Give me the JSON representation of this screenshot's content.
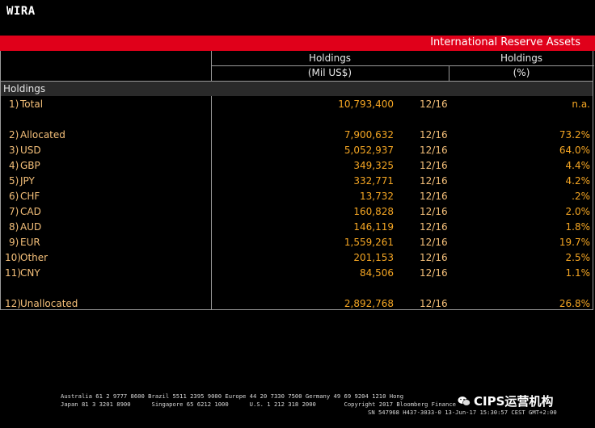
{
  "command": "WIRA",
  "title_bar": "International Reserve Assets",
  "columns": {
    "holdings_label": "Holdings",
    "holdings_unit": "(Mil US$)",
    "pct_label": "Holdings",
    "pct_unit": "(%)"
  },
  "section_label": "Holdings",
  "rows": [
    {
      "idx": "1)",
      "label": "Total",
      "value": "10,793,400",
      "date": "12/16",
      "pct": "n.a."
    },
    {
      "idx": "2)",
      "label": "Allocated",
      "value": "7,900,632",
      "date": "12/16",
      "pct": "73.2%"
    },
    {
      "idx": "3)",
      "label": "USD",
      "value": "5,052,937",
      "date": "12/16",
      "pct": "64.0%"
    },
    {
      "idx": "4)",
      "label": "GBP",
      "value": "349,325",
      "date": "12/16",
      "pct": "4.4%"
    },
    {
      "idx": "5)",
      "label": "JPY",
      "value": "332,771",
      "date": "12/16",
      "pct": "4.2%"
    },
    {
      "idx": "6)",
      "label": "CHF",
      "value": "13,732",
      "date": "12/16",
      "pct": ".2%"
    },
    {
      "idx": "7)",
      "label": "CAD",
      "value": "160,828",
      "date": "12/16",
      "pct": "2.0%"
    },
    {
      "idx": "8)",
      "label": "AUD",
      "value": "146,119",
      "date": "12/16",
      "pct": "1.8%"
    },
    {
      "idx": "9)",
      "label": "EUR",
      "value": "1,559,261",
      "date": "12/16",
      "pct": "19.7%"
    },
    {
      "idx": "10)",
      "label": "Other",
      "value": "201,153",
      "date": "12/16",
      "pct": "2.5%"
    },
    {
      "idx": "11)",
      "label": "CNY",
      "value": "84,506",
      "date": "12/16",
      "pct": "1.1%"
    },
    {
      "idx": "12)",
      "label": "Unallocated",
      "value": "2,892,768",
      "date": "12/16",
      "pct": "26.8%"
    }
  ],
  "footer": {
    "line1": "Australia 61 2 9777 8600 Brazil 5511 2395 9000 Europe 44 20 7330 7500 Germany 49 69 9204 1210 Hong",
    "line2": "Japan 81 3 3201 8900      Singapore 65 6212 1000      U.S. 1 212 318 2000        Copyright 2017 Bloomberg Finance",
    "line3": "SN 547968 H437-3033-0 13-Jun-17 15:30:57 CEST GMT+2:00"
  },
  "watermark": "CIPS运营机构"
}
